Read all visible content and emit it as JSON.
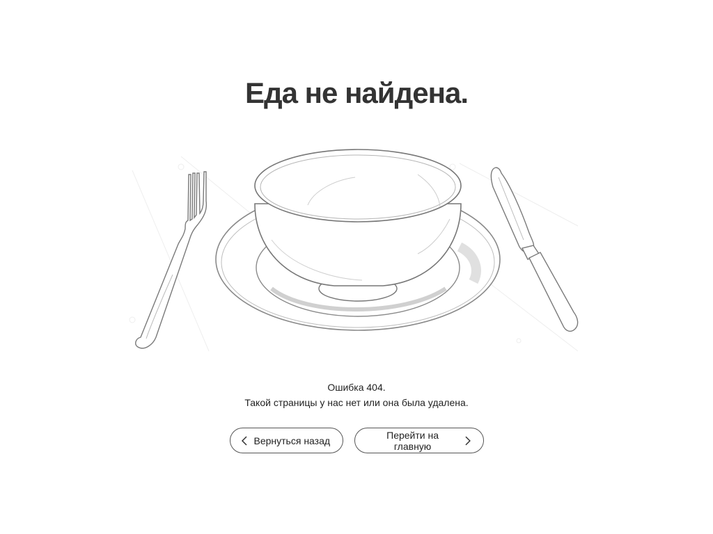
{
  "page": {
    "title": "Еда не найдена."
  },
  "illustration": {
    "icon": "empty-plate-bowl-fork-knife-illustration"
  },
  "error": {
    "code_line": "Ошибка 404.",
    "description": "Такой страницы у нас нет или она была удалена."
  },
  "actions": {
    "back_label": "Вернуться назад",
    "back_icon": "chevron-left-icon",
    "home_label": "Перейти на главную",
    "home_icon": "chevron-right-icon"
  },
  "colors": {
    "background": "#ffffff",
    "text": "#333333",
    "button_border": "#555555"
  }
}
